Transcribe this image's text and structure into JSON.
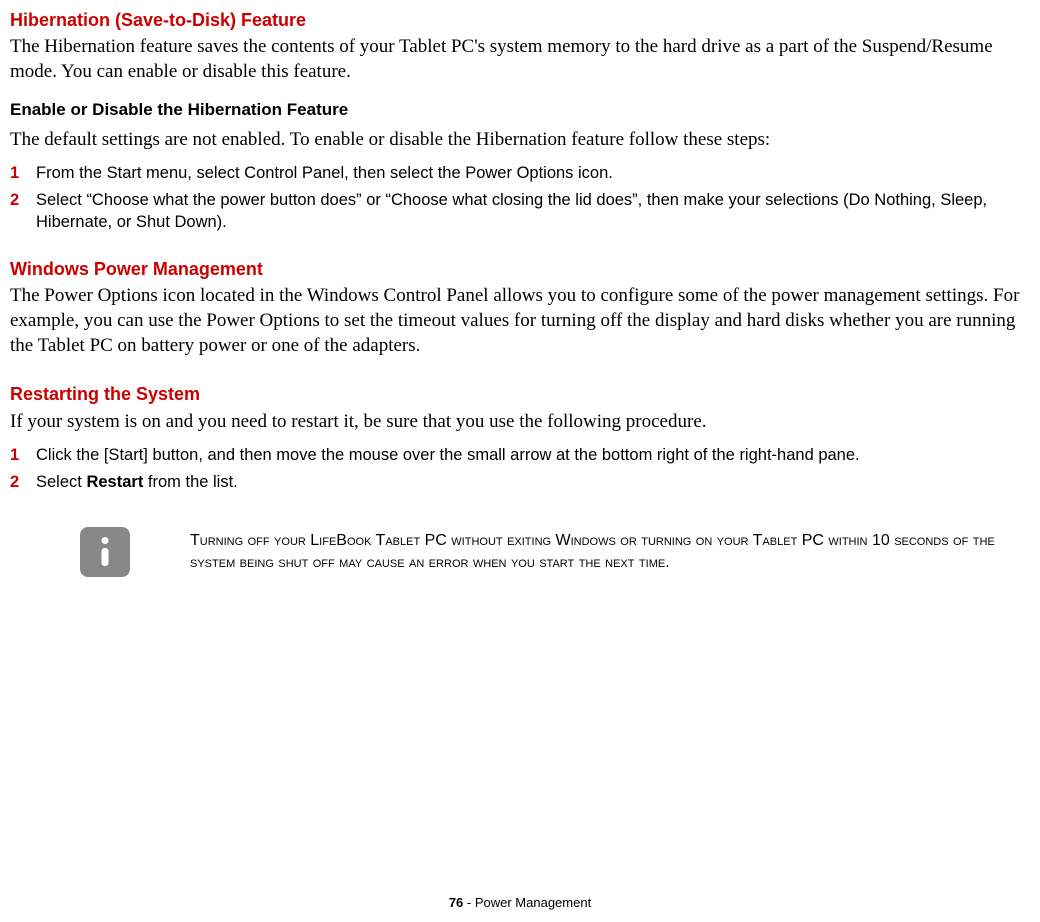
{
  "section_hibernation": {
    "title": "Hibernation (Save-to-Disk) Feature",
    "intro": "The Hibernation feature saves the contents of your Tablet PC's system memory to the hard drive as a part of the Suspend/Resume mode. You can enable or disable this feature.",
    "sub_title": "Enable or Disable the Hibernation Feature",
    "sub_intro": "The default settings are not enabled. To enable or disable the Hibernation feature follow these steps:",
    "steps": [
      {
        "num": "1",
        "text": "From the Start menu, select Control Panel, then select the Power Options icon."
      },
      {
        "num": "2",
        "text": "Select “Choose what the power button does” or “Choose what closing the lid does”, then make your selections (Do Nothing, Sleep, Hibernate, or Shut Down)."
      }
    ]
  },
  "section_power": {
    "title": "Windows Power Management",
    "intro": "The Power Options icon located in the Windows Control Panel allows you to configure some of the power management settings. For example, you can use the Power Options to set the timeout values for turning off the display and hard disks whether you are running the Tablet PC on battery power or one of the adapters."
  },
  "section_restart": {
    "title": "Restarting the System",
    "intro": "If your system is on and you need to restart it, be sure that you use the following procedure.",
    "steps": [
      {
        "num": "1",
        "text": "Click the [Start] button, and then move the mouse over the small arrow at the bottom right of the right-hand pane."
      },
      {
        "num": "2",
        "prefix": "Select ",
        "bold": "Restart",
        "suffix": " from the list."
      }
    ]
  },
  "info_note": "Turning off your LifeBook Tablet PC without exiting Windows or turning on your Tablet PC within 10 seconds of the system being shut off may cause an error when you start the next time.",
  "footer": {
    "page": "76",
    "sep": " - ",
    "label": "Power Management"
  }
}
